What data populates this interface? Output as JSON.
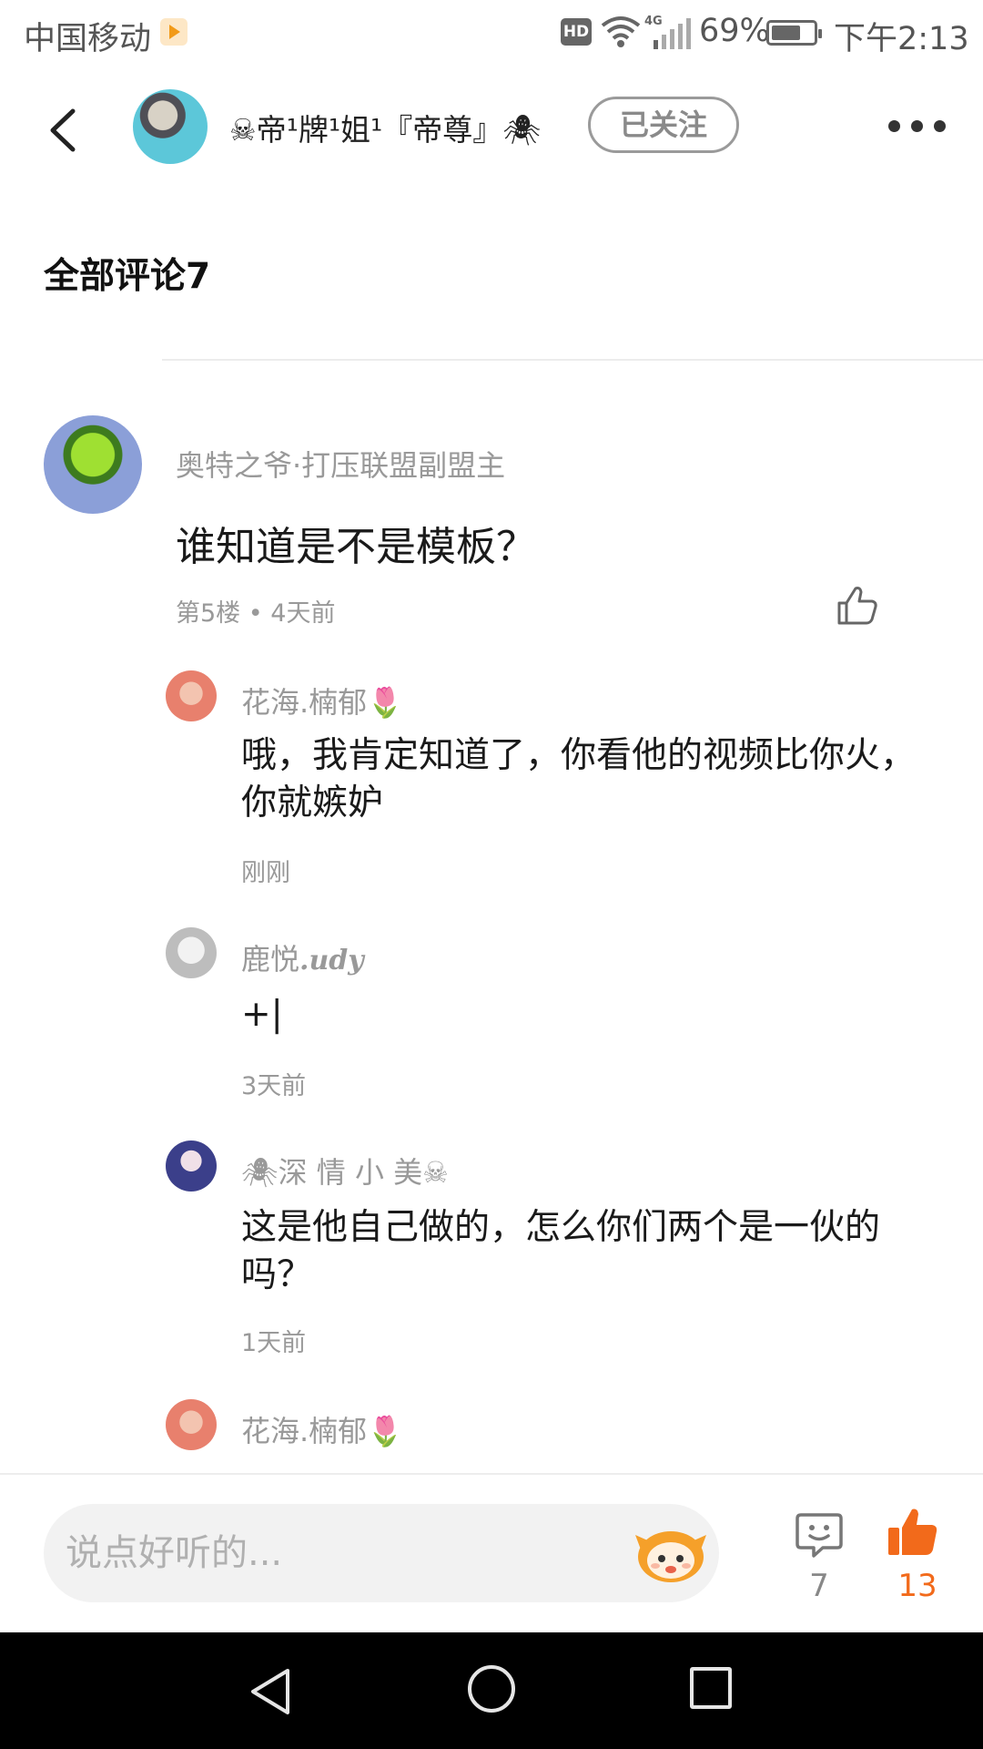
{
  "status_bar": {
    "carrier": "中国移动",
    "hd_badge": "HD",
    "network_type": "4G",
    "battery": "69%",
    "time": "下午2:13"
  },
  "header": {
    "author_name": "☠帝¹牌¹姐¹『帝尊』🕷",
    "follow_label": "已关注"
  },
  "comments_title": "全部评论7",
  "main_comment": {
    "username": "奥特之爷·打压联盟副盟主",
    "text": "谁知道是不是模板？",
    "meta": "第5楼 • 4天前"
  },
  "replies": [
    {
      "username": "花海.楠郁🌷",
      "text": "哦，我肯定知道了，你看他的视频比你火，你就嫉妒",
      "time": "刚刚"
    },
    {
      "username": "鹿悦",
      "username_suffix": ".udy",
      "text": "+|",
      "time": "3天前"
    },
    {
      "username": "🕷深 情 小 美☠",
      "text": "这是他自己做的，怎么你们两个是一伙的吗？",
      "time": "1天前"
    },
    {
      "username": "花海.楠郁🌷",
      "text": "",
      "time": ""
    }
  ],
  "bottom_bar": {
    "input_placeholder": "说点好听的...",
    "comment_count": "7",
    "like_count": "13"
  },
  "colors": {
    "accent": "#f26a1b",
    "muted_text": "#999999",
    "button_border": "#9a9a9a"
  }
}
